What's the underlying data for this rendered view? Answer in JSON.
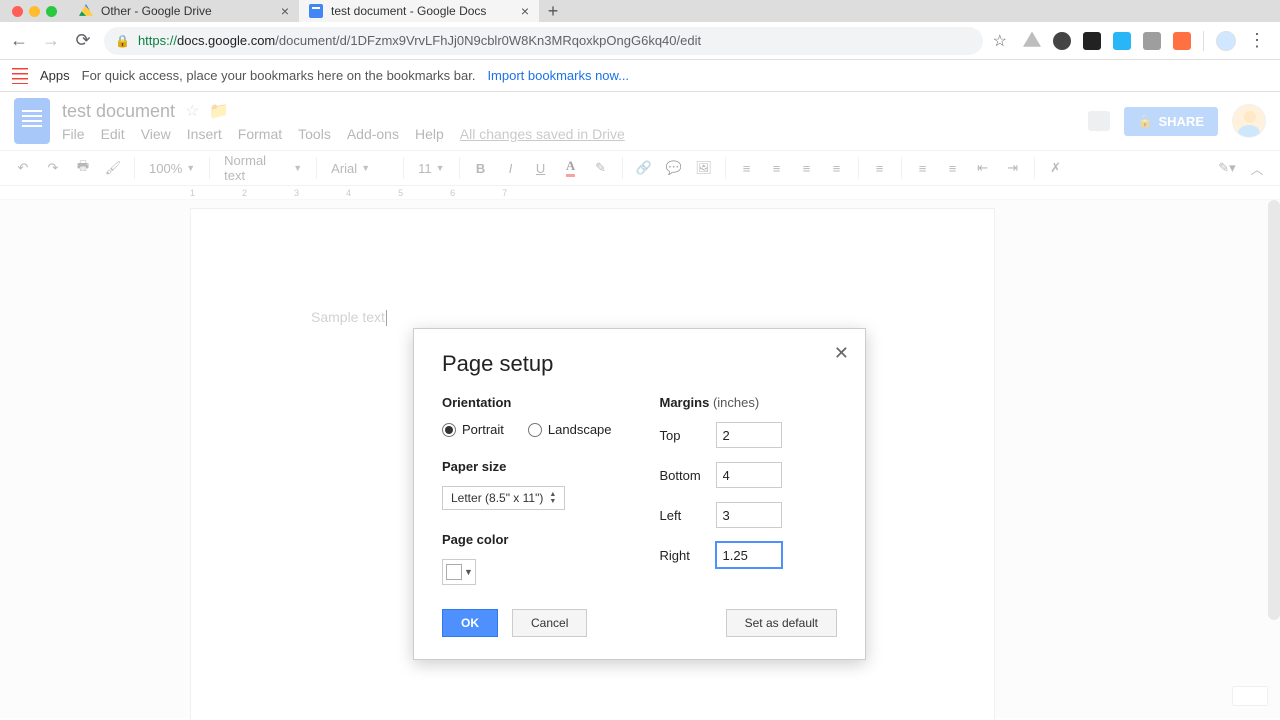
{
  "browser": {
    "tabs": [
      {
        "title": "Other - Google Drive",
        "active": false
      },
      {
        "title": "test document - Google Docs",
        "active": true
      }
    ],
    "url": {
      "proto": "https://",
      "host": "docs.google.com",
      "path": "/document/d/1DFzmx9VrvLFhJj0N9cblr0W8Kn3MRqoxkpOngG6kq40/edit"
    },
    "bookmarks": {
      "apps": "Apps",
      "msg": "For quick access, place your bookmarks here on the bookmarks bar.",
      "link": "Import bookmarks now..."
    }
  },
  "docs": {
    "title": "test document",
    "menu": {
      "file": "File",
      "edit": "Edit",
      "view": "View",
      "insert": "Insert",
      "format": "Format",
      "tools": "Tools",
      "addons": "Add-ons",
      "help": "Help",
      "saved": "All changes saved in Drive"
    },
    "share": "SHARE",
    "format_bar": {
      "zoom": "100%",
      "style": "Normal text",
      "font": "Arial",
      "size": "11"
    },
    "sample": "Sample text"
  },
  "dialog": {
    "title": "Page setup",
    "orientation": {
      "label": "Orientation",
      "portrait": "Portrait",
      "landscape": "Landscape",
      "value": "portrait"
    },
    "paper": {
      "label": "Paper size",
      "value": "Letter (8.5\" x 11\")"
    },
    "color": {
      "label": "Page color"
    },
    "margins": {
      "label": "Margins",
      "unit": "(inches)",
      "top_l": "Top",
      "bottom_l": "Bottom",
      "left_l": "Left",
      "right_l": "Right",
      "top": "2",
      "bottom": "4",
      "left": "3",
      "right": "1.25"
    },
    "buttons": {
      "ok": "OK",
      "cancel": "Cancel",
      "default": "Set as default"
    }
  }
}
